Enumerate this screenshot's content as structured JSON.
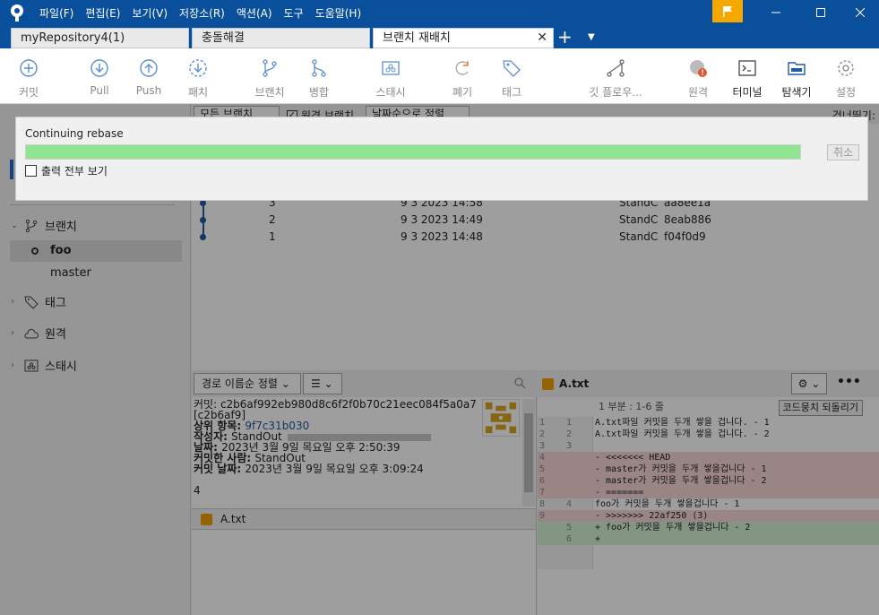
{
  "menu": [
    "파일(F)",
    "편집(E)",
    "보기(V)",
    "저장소(R)",
    "액션(A)",
    "도구",
    "도움말(H)"
  ],
  "tabs": [
    {
      "label": "myRepository4(1)"
    },
    {
      "label": "충돌해결"
    },
    {
      "label": "브랜치 재배치",
      "close": "✕"
    }
  ],
  "tab_add": "+",
  "toolbar": {
    "commit": "커밋",
    "pull": "Pull",
    "push": "Push",
    "fetch": "패치",
    "branch": "브랜치",
    "merge": "병합",
    "stash": "스태시",
    "discard": "폐기",
    "tag": "태그",
    "git_flow": "깃 플로우...",
    "remote": "원격",
    "terminal": "터미널",
    "explorer": "탐색기",
    "settings": "설정"
  },
  "filter": {
    "all_branches": "모든 브랜치",
    "remote_branches": "원격 브랜치",
    "sort": "날짜순으로 정렬",
    "jump": "건너뛰기:"
  },
  "sidebar": {
    "branches_label": "브랜치",
    "branches": [
      {
        "name": "foo",
        "current": true
      },
      {
        "name": "master",
        "current": false
      }
    ],
    "tags_label": "태그",
    "remotes_label": "원격",
    "stashes_label": "스태시"
  },
  "commits": [
    {
      "desc": "3",
      "date": "9 3 2023 14:58",
      "author": "StandC",
      "hash": "aa8ee1a"
    },
    {
      "desc": "2",
      "date": "9 3 2023 14:49",
      "author": "StandC",
      "hash": "8eab886"
    },
    {
      "desc": "1",
      "date": "9 3 2023 14:48",
      "author": "StandC",
      "hash": "f04f0d9"
    }
  ],
  "details": {
    "sort_label": "경로 이름순 정렬",
    "view_icon": "☰",
    "commit_line": "커밋: c2b6af992eb980d8c6f2f0b70c21eec084f5a0a7",
    "short_hash": "[c2b6af9]",
    "parent_label": "상위 항목: ",
    "parent_value": "9f7c31b030",
    "author_label": "작성자: ",
    "author_value": "StandOut",
    "date_label": "날짜: ",
    "date_value": "2023년 3월 9일 목요일 오후 2:50:39",
    "committer_label": "커밋한 사람: ",
    "committer_value": "StandOut",
    "commit_date_label": "커밋 날짜: ",
    "commit_date_value": "2023년 3월 9일 목요일 오후 3:09:24",
    "message": "4",
    "file": "A.txt"
  },
  "diff": {
    "file": "A.txt",
    "hunk": "1 부분 : 1-6 줄",
    "revert_label": "코드뭉치 되돌리기",
    "lines": [
      {
        "n1": "1",
        "n2": "1",
        "type": "ctx",
        "text": " A.txt파일 커밋을 두개 쌓을 겁니다. - 1"
      },
      {
        "n1": "2",
        "n2": "2",
        "type": "ctx",
        "text": " A.txt파일 커밋을 두개 쌓을 겁니다. - 2"
      },
      {
        "n1": "3",
        "n2": "3",
        "type": "ctx",
        "text": ""
      },
      {
        "n1": "4",
        "n2": "",
        "type": "del",
        "text": "- <<<<<<< HEAD"
      },
      {
        "n1": "5",
        "n2": "",
        "type": "del",
        "text": "- master가 커밋을 두개 쌓을겁니다 - 1"
      },
      {
        "n1": "6",
        "n2": "",
        "type": "del",
        "text": "- master가 커밋을 두개 쌓을겁니다 - 2"
      },
      {
        "n1": "7",
        "n2": "",
        "type": "del",
        "text": "- ======="
      },
      {
        "n1": "8",
        "n2": "4",
        "type": "ctx",
        "text": " foo가 커밋을 두개 쌓을겁니다 - 1"
      },
      {
        "n1": "9",
        "n2": "",
        "type": "del",
        "text": "- >>>>>>> 22af250 (3)"
      },
      {
        "n1": "",
        "n2": "5",
        "type": "add",
        "text": "+ foo가 커밋을 두개 쌓을겁니다 - 2"
      },
      {
        "n1": "",
        "n2": "6",
        "type": "add",
        "text": "+"
      }
    ]
  },
  "dialog": {
    "title": "Continuing rebase",
    "progress": 1.0,
    "cancel": "취소",
    "show_output": "출력 전부 보기"
  },
  "colors": {
    "titlebar": "#0a4f9c",
    "progress": "#90e590",
    "accent": "#f6a800",
    "graph": "#1f5aa6"
  }
}
